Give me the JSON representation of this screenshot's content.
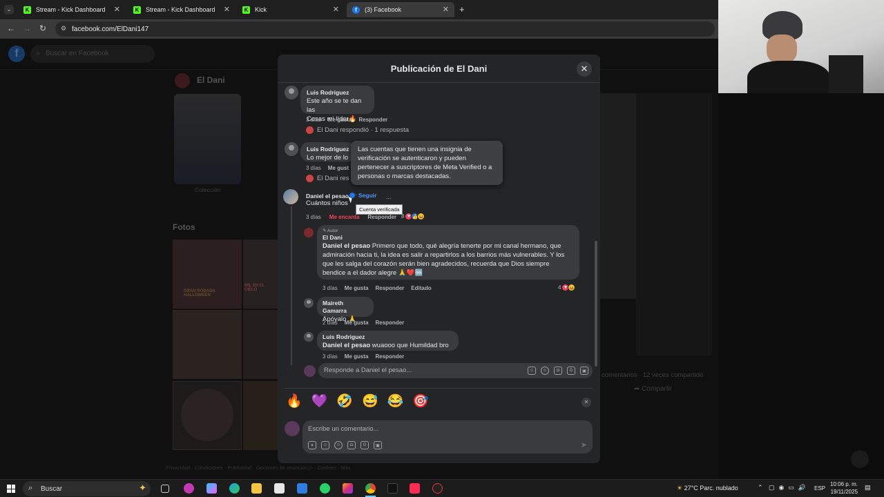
{
  "browser": {
    "tabs": [
      {
        "title": "Stream - Kick Dashboard",
        "fav": "K",
        "color": "#53fc18"
      },
      {
        "title": "Stream - Kick Dashboard",
        "fav": "K",
        "color": "#53fc18"
      },
      {
        "title": "Kick",
        "fav": "K",
        "color": "#53fc18"
      },
      {
        "title": "(3) Facebook",
        "fav": "f",
        "color": "#1877f2"
      }
    ],
    "new_tab": "+",
    "url": "facebook.com/ElDani147"
  },
  "facebook_bg": {
    "search_placeholder": "Buscar en Facebook",
    "profile_name": "El Dani",
    "coleccion": "Colección",
    "fotos": "Fotos",
    "fotos_captions": [
      "GRAN RODADA HALLOWEEN",
      "MIL EN EL CIELO"
    ],
    "stats": "comentarios   12 veces compartido",
    "compartir": "Compartir",
    "footer": "Privacidad · Condiciones · Publicidad · Opciones de anuncios ▷ · Cookies · Más"
  },
  "modal": {
    "title": "Publicación de El Dani",
    "comments": [
      {
        "author": "Luis Rodriguez",
        "text_line1": "Este año se te dan las",
        "text_line2": "Cosas mi líder🔥",
        "time": "3 días",
        "like": "Me gusta",
        "reply": "Responder",
        "replied": "El Dani respondió · 1 respuesta"
      },
      {
        "author": "Luis Rodriguez",
        "text_line1": "Lo mejor de lo",
        "time": "3 días",
        "like": "Me gust",
        "replied": "El Dani res"
      },
      {
        "author": "Daniel el pesao",
        "follow": "Seguir",
        "more": "...",
        "text_line1": "Cuántos niños",
        "time": "3 días",
        "like": "Me encanta",
        "reply": "Responder",
        "react_count": "8"
      }
    ],
    "verified_tooltip": "Las cuentas que tienen una insignia de verificación se autenticaron y pueden pertenecer a suscriptores de Meta Verified o a personas o marcas destacadas.",
    "verified_mini": "Cuenta verificada",
    "author_reply": {
      "badge": "✎ Autor",
      "author": "El Dani",
      "mention": "Daniel el pesao",
      "text": " Primero que todo, qué alegría tenerte por mi canal hermano, que admiración hacia ti, la idea es salir a repartirlos a los barrios más vulnerables. Y los que les salga del corazón serán bien agradecidos, recuerda que Dios siempre bendice a el dador alegre 🙏❤️🆒",
      "time": "3 días",
      "like": "Me gusta",
      "reply": "Responder",
      "edited": "Editado",
      "react_count": "4"
    },
    "nested": [
      {
        "author": "Maireth Gamarra",
        "text": "Apóyalo 🙏",
        "time": "2 días",
        "like": "Me gusta",
        "reply": "Responder"
      },
      {
        "author": "Luis Rodriguez",
        "mention": "Daniel el pesao",
        "text": " wuaooo que Humildad bro",
        "time": "3 días",
        "like": "Me gusta",
        "reply": "Responder"
      }
    ],
    "reply_placeholder": "Responde a Daniel el pesao...",
    "emojis": [
      "🔥",
      "💜",
      "🤣",
      "😅",
      "😂",
      "🎯"
    ],
    "comment_placeholder": "Escribe un comentario..."
  },
  "taskbar": {
    "search": "Buscar",
    "weather": "27°C  Parc. nublado",
    "lang": "ESP",
    "time": "10:06 p. m.",
    "date": "19/11/2025"
  }
}
